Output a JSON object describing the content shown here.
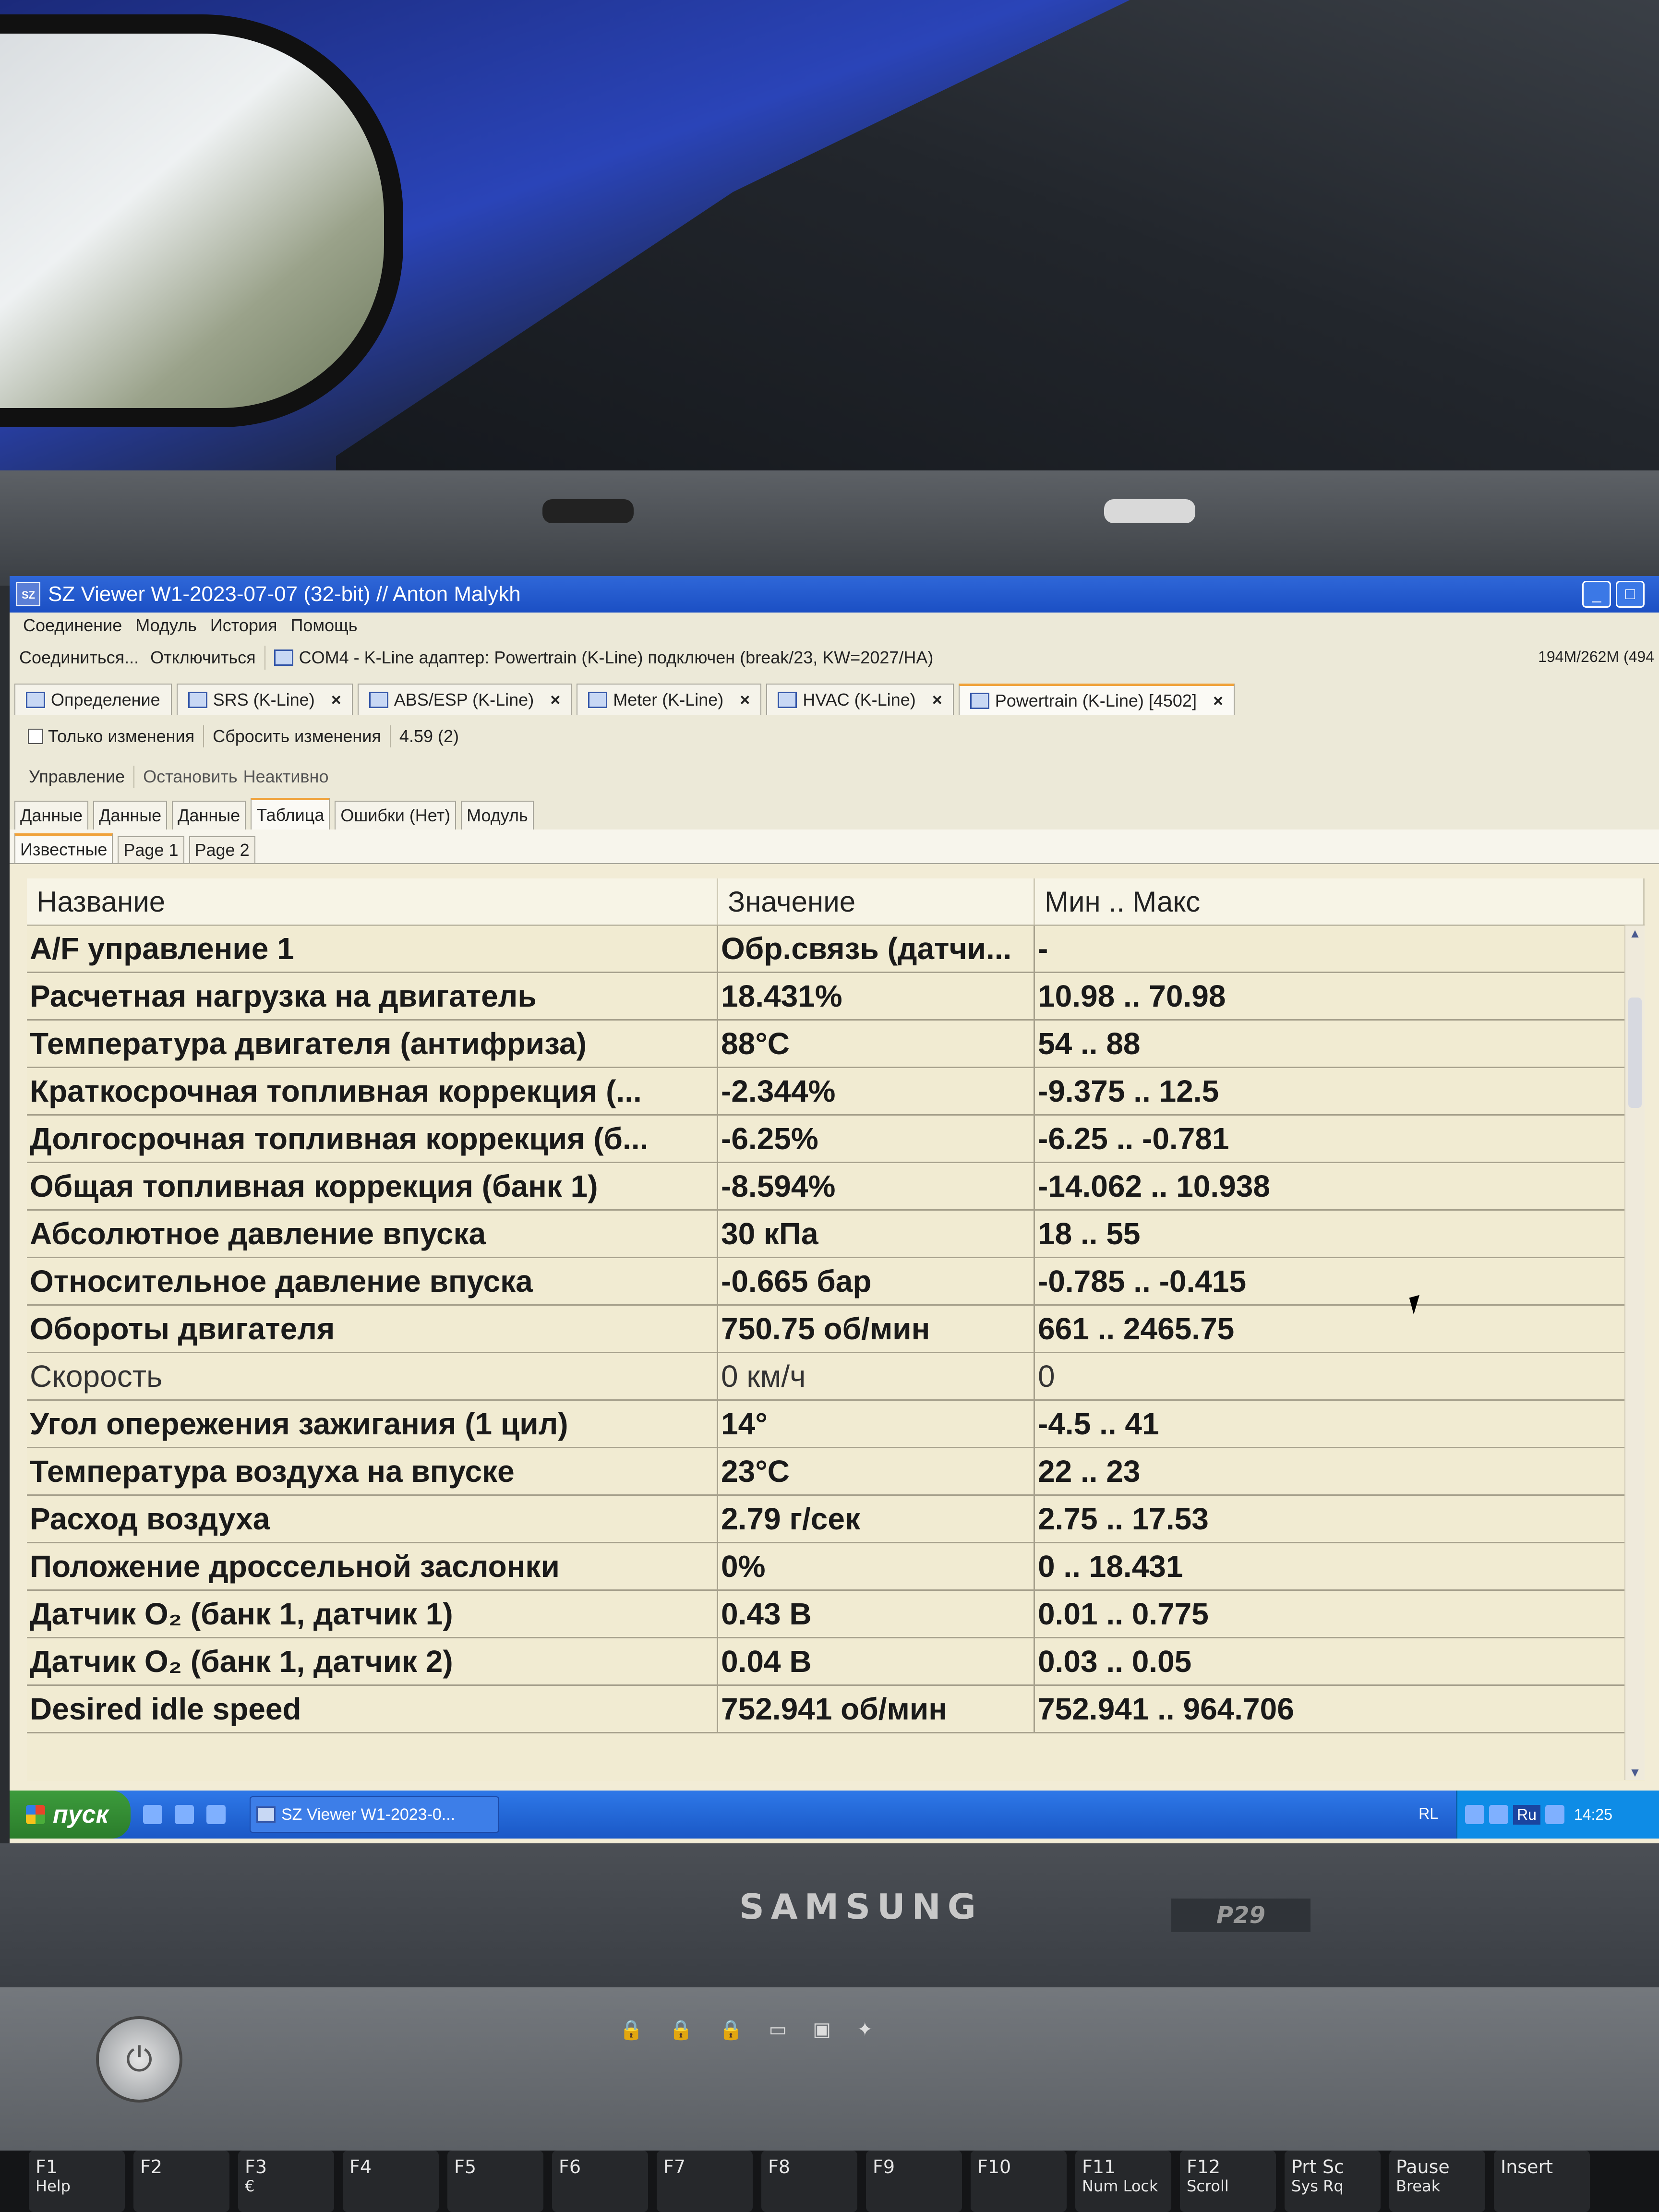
{
  "window": {
    "app_icon": "SZ",
    "title": "SZ Viewer W1-2023-07-07 (32-bit) // Anton Malykh",
    "buttons": [
      "minimize",
      "maximize"
    ]
  },
  "menu": [
    "Соединение",
    "Модуль",
    "История",
    "Помощь"
  ],
  "toolbar": {
    "connect": "Соединиться...",
    "disconnect": "Отключиться",
    "status": "COM4 - K-Line адаптер: Powertrain (K-Line) подключен (break/23, KW=2027/HA)",
    "memory": "194M/262M (494"
  },
  "module_tabs": [
    {
      "label": "Определение",
      "closable": false
    },
    {
      "label": "SRS (K-Line)",
      "closable": true
    },
    {
      "label": "ABS/ESP (K-Line)",
      "closable": true
    },
    {
      "label": "Meter (K-Line)",
      "closable": true
    },
    {
      "label": "HVAC (K-Line)",
      "closable": true
    },
    {
      "label": "Powertrain (K-Line) [4502]",
      "closable": true,
      "active": true
    }
  ],
  "options": {
    "only_changes": "Только изменения",
    "reset_changes": "Сбросить изменения",
    "rate": "4.59 (2)"
  },
  "control": {
    "label": "Управление",
    "stop": "Остановить",
    "state": "Неактивно"
  },
  "view_tabs": [
    "Данные",
    "Данные",
    "Данные",
    "Таблица",
    "Ошибки (Нет)",
    "Модуль"
  ],
  "view_tab_active": 3,
  "page_tabs": [
    "Известные",
    "Page 1",
    "Page 2"
  ],
  "grid": {
    "headers": [
      "Название",
      "Значение",
      "Мин .. Макс"
    ],
    "rows": [
      [
        "A/F управление 1",
        "Обр.связь (датчи...",
        "-"
      ],
      [
        "Расчетная нагрузка на двигатель",
        "18.431%",
        "10.98 .. 70.98"
      ],
      [
        "Температура двигателя (антифриза)",
        "88°C",
        "54 .. 88"
      ],
      [
        "Краткосрочная топливная коррекция (...",
        "-2.344%",
        "-9.375 .. 12.5"
      ],
      [
        "Долгосрочная топливная коррекция (б...",
        "-6.25%",
        "-6.25 .. -0.781"
      ],
      [
        "Общая топливная коррекция (банк 1)",
        "-8.594%",
        "-14.062 .. 10.938"
      ],
      [
        "Абсолютное давление впуска",
        "30 кПа",
        "18 .. 55"
      ],
      [
        "Относительное давление впуска",
        "-0.665 бар",
        "-0.785 .. -0.415"
      ],
      [
        "Обороты двигателя",
        "750.75 об/мин",
        "661 .. 2465.75"
      ],
      [
        "Скорость",
        "0 км/ч",
        "0"
      ],
      [
        "Угол опережения зажигания (1 цил)",
        "14°",
        "-4.5 .. 41"
      ],
      [
        "Температура воздуха на впуске",
        "23°C",
        "22 .. 23"
      ],
      [
        "Расход воздуха",
        "2.79 г/сек",
        "2.75 .. 17.53"
      ],
      [
        "Положение дроссельной заслонки",
        "0%",
        "0 .. 18.431"
      ],
      [
        "Датчик O₂ (банк 1, датчик 1)",
        "0.43 В",
        "0.01 .. 0.775"
      ],
      [
        "Датчик O₂ (банк 1, датчик 2)",
        "0.04 В",
        "0.03 .. 0.05"
      ],
      [
        "Desired idle speed",
        "752.941 об/мин",
        "752.941 .. 964.706"
      ]
    ],
    "inactive_row": 9
  },
  "taskbar": {
    "start": "пуск",
    "task": "SZ Viewer W1-2023-0...",
    "indicator": "RL",
    "lang": "Ru",
    "clock": "14:25"
  },
  "laptop": {
    "brand": "SAMSUNG",
    "model": "P29",
    "keys": [
      [
        "F1",
        "Help"
      ],
      [
        "F2",
        ""
      ],
      [
        "F3",
        "€"
      ],
      [
        "F4",
        ""
      ],
      [
        "F5",
        ""
      ],
      [
        "F6",
        ""
      ],
      [
        "F7",
        ""
      ],
      [
        "F8",
        ""
      ],
      [
        "F9",
        ""
      ],
      [
        "F10",
        ""
      ],
      [
        "F11",
        "Num Lock"
      ],
      [
        "F12",
        "Scroll"
      ],
      [
        "Prt Sc",
        "Sys Rq"
      ],
      [
        "Pause",
        "Break"
      ],
      [
        "Insert",
        ""
      ]
    ]
  }
}
